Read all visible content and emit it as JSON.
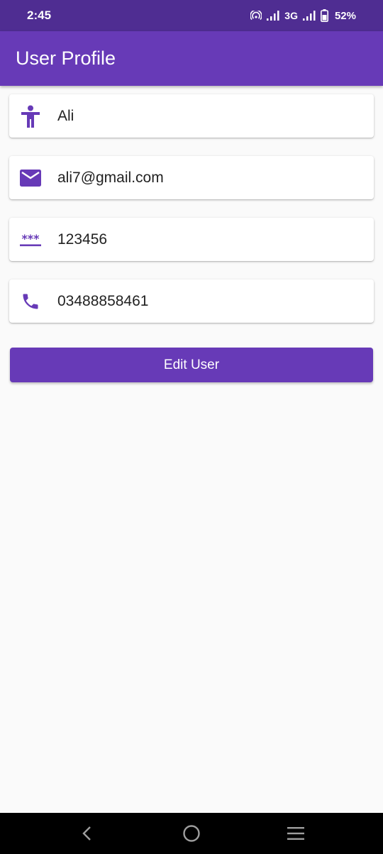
{
  "status_bar": {
    "time": "2:45",
    "network": "3G",
    "battery": "52%"
  },
  "app_bar": {
    "title": "User Profile"
  },
  "profile": {
    "name": {
      "icon": "accessibility-person-icon",
      "value": "Ali"
    },
    "email": {
      "icon": "mail-icon",
      "value": "ali7@gmail.com"
    },
    "password": {
      "icon": "password-icon",
      "value": "123456"
    },
    "phone": {
      "icon": "phone-icon",
      "value": "03488858461"
    }
  },
  "actions": {
    "edit_label": "Edit User"
  },
  "nav_bar": {
    "back": "back-icon",
    "home": "home-icon",
    "recents": "recents-icon"
  },
  "colors": {
    "primary": "#673ab7",
    "status_bar": "#4f2d92",
    "background": "#fafafa"
  }
}
